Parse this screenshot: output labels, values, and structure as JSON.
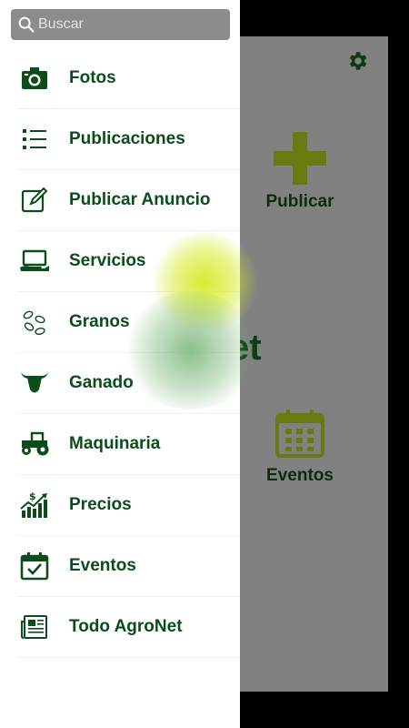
{
  "background": {
    "publicar_label": "Publicar",
    "eventos_label": "Eventos",
    "logo_fragment": "et"
  },
  "search": {
    "placeholder": "Buscar"
  },
  "menu": [
    {
      "label": "Fotos",
      "icon": "camera-icon"
    },
    {
      "label": "Publicaciones",
      "icon": "list-icon"
    },
    {
      "label": "Publicar Anuncio",
      "icon": "edit-icon"
    },
    {
      "label": "Servicios",
      "icon": "laptop-hand-icon"
    },
    {
      "label": "Granos",
      "icon": "beans-icon"
    },
    {
      "label": "Ganado",
      "icon": "cattle-icon"
    },
    {
      "label": "Maquinaria",
      "icon": "tractor-icon"
    },
    {
      "label": "Precios",
      "icon": "price-chart-icon"
    },
    {
      "label": "Eventos",
      "icon": "calendar-icon"
    },
    {
      "label": "Todo AgroNet",
      "icon": "newspaper-icon"
    }
  ],
  "colors": {
    "menu_green": "#0b4d1a",
    "olive": "#6b7a10",
    "drawer_bg": "#ffffff",
    "overlay_gray": "#818181"
  }
}
